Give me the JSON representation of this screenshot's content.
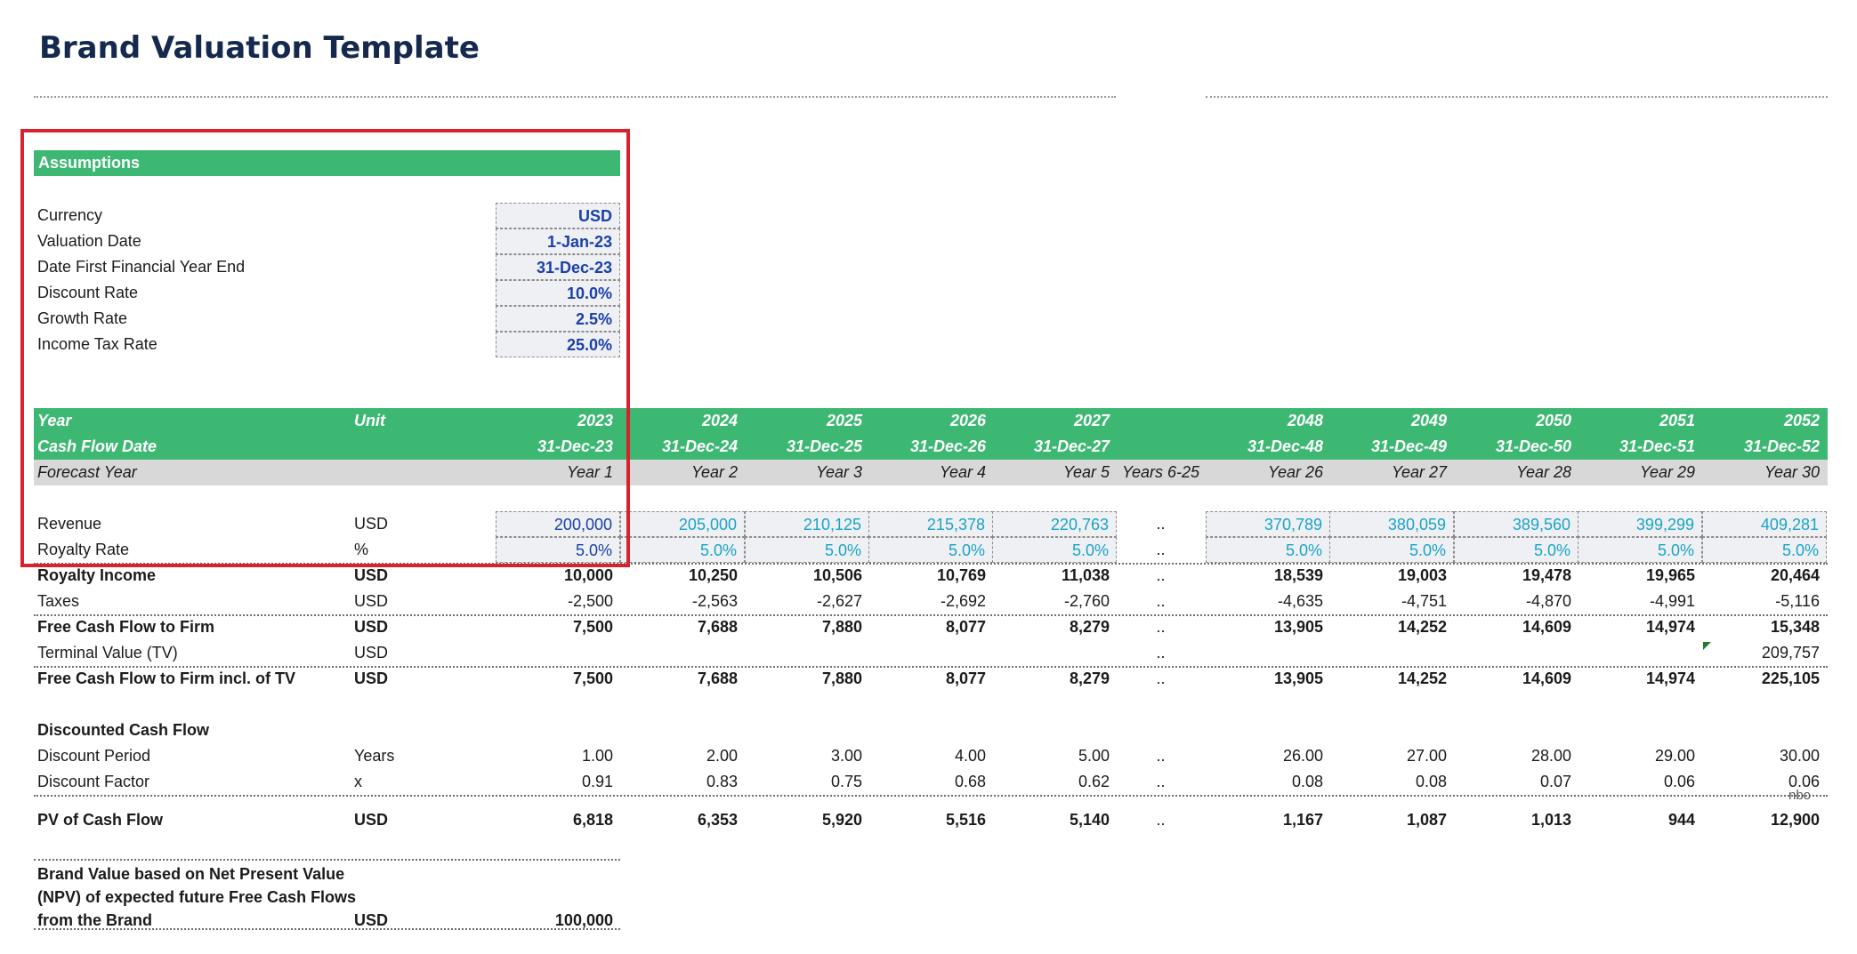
{
  "page_title": "Brand Valuation Template",
  "assumptions": {
    "header": "Assumptions",
    "items": [
      {
        "label": "Currency",
        "value": "USD"
      },
      {
        "label": "Valuation Date",
        "value": "1-Jan-23"
      },
      {
        "label": "Date First Financial Year End",
        "value": "31-Dec-23"
      },
      {
        "label": "Discount Rate",
        "value": "10.0%"
      },
      {
        "label": "Growth Rate",
        "value": "2.5%"
      },
      {
        "label": "Income Tax Rate",
        "value": "25.0%"
      }
    ]
  },
  "table": {
    "header_year_label": "Year",
    "header_unit_label": "Unit",
    "header_cfd_label": "Cash Flow Date",
    "forecast_label": "Forecast Year",
    "gap_label": "Years 6-25",
    "gap_mark": "..",
    "years": [
      "2023",
      "2024",
      "2025",
      "2026",
      "2027",
      "2048",
      "2049",
      "2050",
      "2051",
      "2052"
    ],
    "dates": [
      "31-Dec-23",
      "31-Dec-24",
      "31-Dec-25",
      "31-Dec-26",
      "31-Dec-27",
      "31-Dec-48",
      "31-Dec-49",
      "31-Dec-50",
      "31-Dec-51",
      "31-Dec-52"
    ],
    "forecast_years": [
      "Year 1",
      "Year 2",
      "Year 3",
      "Year 4",
      "Year 5",
      "Year 26",
      "Year 27",
      "Year 28",
      "Year 29",
      "Year 30"
    ],
    "rows": {
      "revenue": {
        "label": "Revenue",
        "unit": "USD",
        "values": [
          "200,000",
          "205,000",
          "210,125",
          "215,378",
          "220,763",
          "370,789",
          "380,059",
          "389,560",
          "399,299",
          "409,281"
        ]
      },
      "royalty_rate": {
        "label": "Royalty Rate",
        "unit": "%",
        "values": [
          "5.0%",
          "5.0%",
          "5.0%",
          "5.0%",
          "5.0%",
          "5.0%",
          "5.0%",
          "5.0%",
          "5.0%",
          "5.0%"
        ]
      },
      "royalty_income": {
        "label": "Royalty Income",
        "unit": "USD",
        "values": [
          "10,000",
          "10,250",
          "10,506",
          "10,769",
          "11,038",
          "18,539",
          "19,003",
          "19,478",
          "19,965",
          "20,464"
        ]
      },
      "taxes": {
        "label": "Taxes",
        "unit": "USD",
        "values": [
          "-2,500",
          "-2,563",
          "-2,627",
          "-2,692",
          "-2,760",
          "-4,635",
          "-4,751",
          "-4,870",
          "-4,991",
          "-5,116"
        ]
      },
      "fcf": {
        "label": "Free Cash Flow to Firm",
        "unit": "USD",
        "values": [
          "7,500",
          "7,688",
          "7,880",
          "8,077",
          "8,279",
          "13,905",
          "14,252",
          "14,609",
          "14,974",
          "15,348"
        ]
      },
      "tv": {
        "label": "Terminal Value (TV)",
        "unit": "USD",
        "values": [
          "",
          "",
          "",
          "",
          "",
          "",
          "",
          "",
          "",
          "209,757"
        ]
      },
      "fcf_tv": {
        "label": "Free Cash Flow to Firm incl. of TV",
        "unit": "USD",
        "values": [
          "7,500",
          "7,688",
          "7,880",
          "8,077",
          "8,279",
          "13,905",
          "14,252",
          "14,609",
          "14,974",
          "225,105"
        ]
      },
      "dcf_header": {
        "label": "Discounted Cash Flow"
      },
      "discount_period": {
        "label": "Discount Period",
        "unit": "Years",
        "values": [
          "1.00",
          "2.00",
          "3.00",
          "4.00",
          "5.00",
          "26.00",
          "27.00",
          "28.00",
          "29.00",
          "30.00"
        ]
      },
      "discount_factor": {
        "label": "Discount Factor",
        "unit": "x",
        "values": [
          "0.91",
          "0.83",
          "0.75",
          "0.68",
          "0.62",
          "0.08",
          "0.08",
          "0.07",
          "0.06",
          "0.06"
        ]
      },
      "pv": {
        "label": "PV of Cash Flow",
        "unit": "USD",
        "values": [
          "6,818",
          "6,353",
          "5,920",
          "5,516",
          "5,140",
          "1,167",
          "1,087",
          "1,013",
          "944",
          "12,900"
        ]
      }
    },
    "clipped_note": "nbo",
    "brand_value": {
      "label_lines": [
        "Brand Value based on Net Present Value",
        "(NPV) of expected future Free Cash Flows",
        "from the Brand"
      ],
      "unit": "USD",
      "value": "100,000"
    }
  },
  "colors": {
    "band": "#3db873",
    "title": "#14294d",
    "input_blue": "#1a3fa8",
    "input_cyan": "#1aa3c8",
    "highlight": "#d8232e"
  }
}
